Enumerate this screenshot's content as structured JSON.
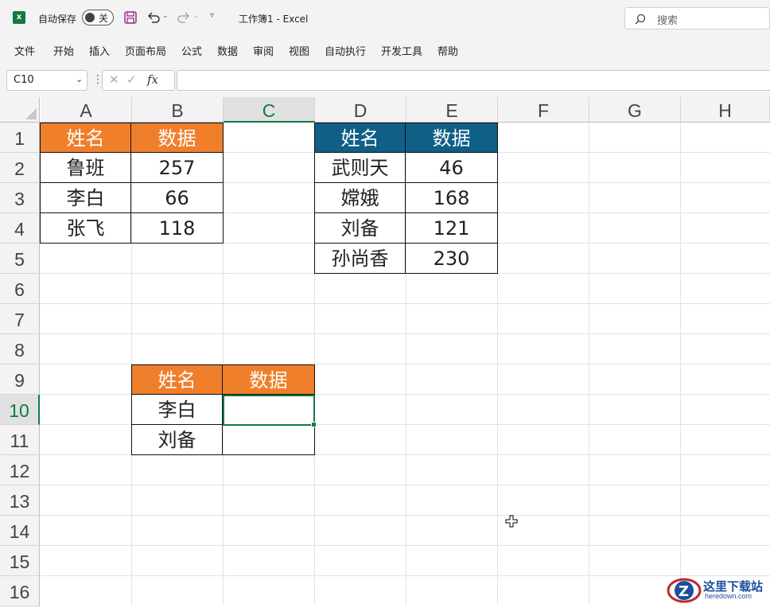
{
  "app": {
    "autosave_label": "自动保存",
    "autosave_state": "关",
    "workbook_title": "工作簿1  -  Excel",
    "search_placeholder": "搜索"
  },
  "menu": [
    "文件",
    "开始",
    "插入",
    "页面布局",
    "公式",
    "数据",
    "审阅",
    "视图",
    "自动执行",
    "开发工具",
    "帮助"
  ],
  "formula_bar": {
    "name_box": "C10",
    "fx_label": "fx",
    "formula": ""
  },
  "columns": [
    "A",
    "B",
    "C",
    "D",
    "E",
    "F",
    "G",
    "H"
  ],
  "selected_column": "C",
  "rows": [
    "1",
    "2",
    "3",
    "4",
    "5",
    "6",
    "7",
    "8",
    "9",
    "10",
    "11",
    "12",
    "13",
    "14",
    "15",
    "16"
  ],
  "selected_row": "10",
  "table1": {
    "headers": [
      "姓名",
      "数据"
    ],
    "rows": [
      [
        "鲁班",
        "257"
      ],
      [
        "李白",
        "66"
      ],
      [
        "张飞",
        "118"
      ]
    ],
    "header_color": "#f07f2b"
  },
  "table2": {
    "headers": [
      "姓名",
      "数据"
    ],
    "rows": [
      [
        "武则天",
        "46"
      ],
      [
        "嫦娥",
        "168"
      ],
      [
        "刘备",
        "121"
      ],
      [
        "孙尚香",
        "230"
      ]
    ],
    "header_color": "#0f5f87"
  },
  "table3": {
    "headers": [
      "姓名",
      "数据"
    ],
    "rows": [
      [
        "李白",
        ""
      ],
      [
        "刘备",
        ""
      ]
    ],
    "header_color": "#f07f2b"
  },
  "watermark": {
    "text": "这里下载站",
    "url_text": "heredown.com"
  },
  "accent_color": "#107c41"
}
